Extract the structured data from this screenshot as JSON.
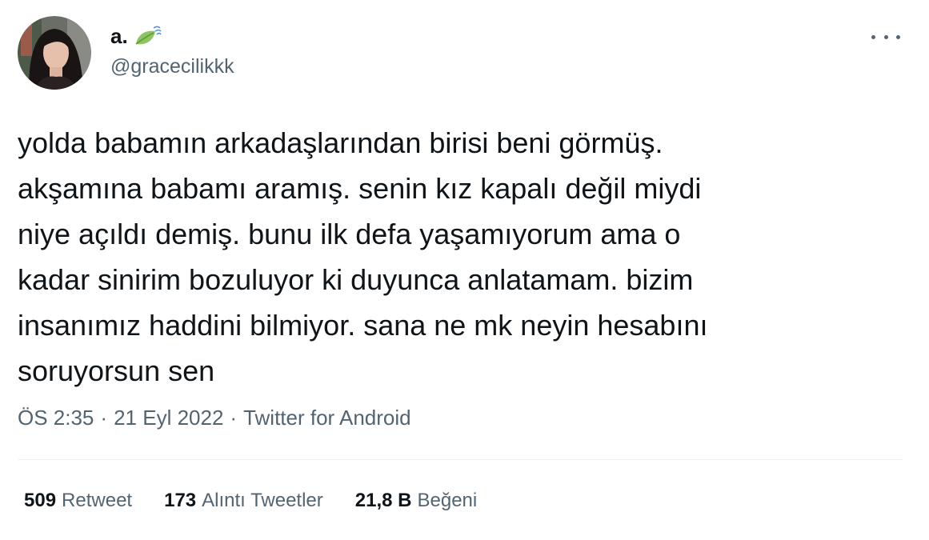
{
  "user": {
    "display_name": "a.",
    "handle": "@gracecilikkk",
    "emoji_icon": "leaf-fluttering-in-wind-icon"
  },
  "tweet": {
    "lines": [
      "yolda babamın arkadaşlarından birisi beni görmüş.",
      "akşamına babamı aramış. senin kız kapalı değil miydi",
      "niye açıldı demiş. bunu ilk defa yaşamıyorum ama o",
      "kadar sinirim bozuluyor ki duyunca anlatamam. bizim",
      "insanımız haddini bilmiyor. sana ne mk neyin hesabını",
      "soruyorsun sen"
    ]
  },
  "meta": {
    "time": "ÖS 2:35",
    "date": "21 Eyl 2022",
    "source": "Twitter for Android",
    "separator": "·"
  },
  "stats": {
    "retweets": {
      "count": "509",
      "label": "Retweet"
    },
    "quotes": {
      "count": "173",
      "label": "Alıntı Tweetler"
    },
    "likes": {
      "count": "21,8 B",
      "label": "Beğeni"
    }
  },
  "colors": {
    "text_primary": "#0f1419",
    "text_secondary": "#536471",
    "divider": "#eff3f4",
    "leaf": "#8fc463"
  }
}
